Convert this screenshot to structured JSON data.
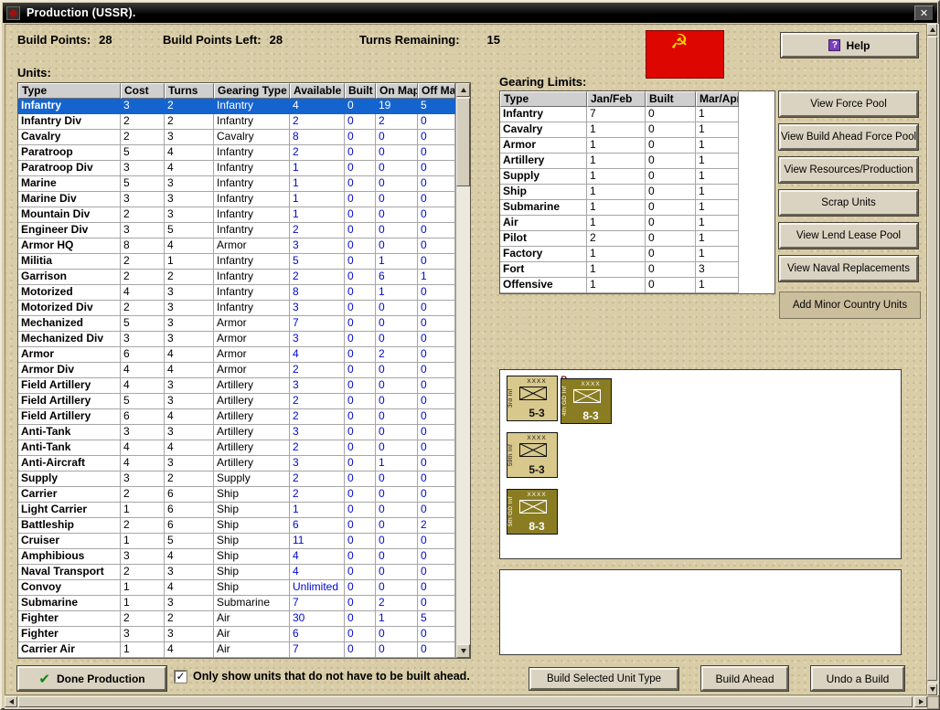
{
  "window": {
    "title": "Production (USSR).",
    "close_glyph": "✕"
  },
  "header": {
    "build_points_label": "Build Points:",
    "build_points": "28",
    "build_points_left_label": "Build Points Left:",
    "build_points_left": "28",
    "turns_remaining_label": "Turns Remaining:",
    "turns_remaining": "15",
    "help_label": "Help",
    "help_icon_glyph": "?"
  },
  "flag": {
    "country": "USSR",
    "emblem": "☭"
  },
  "units": {
    "label": "Units:",
    "columns": [
      "Type",
      "Cost",
      "Turns",
      "Gearing Type",
      "Available",
      "Built",
      "On Map",
      "Off Map"
    ],
    "selected_index": 0,
    "rows": [
      [
        "Infantry",
        3,
        2,
        "Infantry",
        4,
        0,
        19,
        5
      ],
      [
        "Infantry Div",
        2,
        2,
        "Infantry",
        2,
        0,
        2,
        0
      ],
      [
        "Cavalry",
        2,
        3,
        "Cavalry",
        8,
        0,
        0,
        0
      ],
      [
        "Paratroop",
        5,
        4,
        "Infantry",
        2,
        0,
        0,
        0
      ],
      [
        "Paratroop Div",
        3,
        4,
        "Infantry",
        1,
        0,
        0,
        0
      ],
      [
        "Marine",
        5,
        3,
        "Infantry",
        1,
        0,
        0,
        0
      ],
      [
        "Marine Div",
        3,
        3,
        "Infantry",
        1,
        0,
        0,
        0
      ],
      [
        "Mountain Div",
        2,
        3,
        "Infantry",
        1,
        0,
        0,
        0
      ],
      [
        "Engineer Div",
        3,
        5,
        "Infantry",
        2,
        0,
        0,
        0
      ],
      [
        "Armor HQ",
        8,
        4,
        "Armor",
        3,
        0,
        0,
        0
      ],
      [
        "Militia",
        2,
        1,
        "Infantry",
        5,
        0,
        1,
        0
      ],
      [
        "Garrison",
        2,
        2,
        "Infantry",
        2,
        0,
        6,
        1
      ],
      [
        "Motorized",
        4,
        3,
        "Infantry",
        8,
        0,
        1,
        0
      ],
      [
        "Motorized Div",
        2,
        3,
        "Infantry",
        3,
        0,
        0,
        0
      ],
      [
        "Mechanized",
        5,
        3,
        "Armor",
        7,
        0,
        0,
        0
      ],
      [
        "Mechanized Div",
        3,
        3,
        "Armor",
        3,
        0,
        0,
        0
      ],
      [
        "Armor",
        6,
        4,
        "Armor",
        4,
        0,
        2,
        0
      ],
      [
        "Armor Div",
        4,
        4,
        "Armor",
        2,
        0,
        0,
        0
      ],
      [
        "Field Artillery",
        4,
        3,
        "Artillery",
        3,
        0,
        0,
        0
      ],
      [
        "Field Artillery",
        5,
        3,
        "Artillery",
        2,
        0,
        0,
        0
      ],
      [
        "Field Artillery",
        6,
        4,
        "Artillery",
        2,
        0,
        0,
        0
      ],
      [
        "Anti-Tank",
        3,
        3,
        "Artillery",
        3,
        0,
        0,
        0
      ],
      [
        "Anti-Tank",
        4,
        4,
        "Artillery",
        2,
        0,
        0,
        0
      ],
      [
        "Anti-Aircraft",
        4,
        3,
        "Artillery",
        3,
        0,
        1,
        0
      ],
      [
        "Supply",
        3,
        2,
        "Supply",
        2,
        0,
        0,
        0
      ],
      [
        "Carrier",
        2,
        6,
        "Ship",
        2,
        0,
        0,
        0
      ],
      [
        "Light Carrier",
        1,
        6,
        "Ship",
        1,
        0,
        0,
        0
      ],
      [
        "Battleship",
        2,
        6,
        "Ship",
        6,
        0,
        0,
        2
      ],
      [
        "Cruiser",
        1,
        5,
        "Ship",
        11,
        0,
        0,
        0
      ],
      [
        "Amphibious",
        3,
        4,
        "Ship",
        4,
        0,
        0,
        0
      ],
      [
        "Naval Transport",
        2,
        3,
        "Ship",
        4,
        0,
        0,
        0
      ],
      [
        "Convoy",
        1,
        4,
        "Ship",
        "Unlimited",
        0,
        0,
        0
      ],
      [
        "Submarine",
        1,
        3,
        "Submarine",
        7,
        0,
        2,
        0
      ],
      [
        "Fighter",
        2,
        2,
        "Air",
        30,
        0,
        1,
        5
      ],
      [
        "Fighter",
        3,
        3,
        "Air",
        6,
        0,
        0,
        0
      ],
      [
        "Carrier Air",
        1,
        4,
        "Air",
        7,
        0,
        0,
        0
      ]
    ]
  },
  "gearing": {
    "label": "Gearing Limits:",
    "columns": [
      "Type",
      "Jan/Feb",
      "Built",
      "Mar/Apr"
    ],
    "rows": [
      [
        "Infantry",
        7,
        0,
        1
      ],
      [
        "Cavalry",
        1,
        0,
        1
      ],
      [
        "Armor",
        1,
        0,
        1
      ],
      [
        "Artillery",
        1,
        0,
        1
      ],
      [
        "Supply",
        1,
        0,
        1
      ],
      [
        "Ship",
        1,
        0,
        1
      ],
      [
        "Submarine",
        1,
        0,
        1
      ],
      [
        "Air",
        1,
        0,
        1
      ],
      [
        "Pilot",
        2,
        0,
        1
      ],
      [
        "Factory",
        1,
        0,
        1
      ],
      [
        "Fort",
        1,
        0,
        3
      ],
      [
        "Offensive",
        1,
        0,
        1
      ]
    ]
  },
  "side_buttons": [
    "View Force Pool",
    "View Build Ahead Force Pool",
    "View Resources/Production",
    "Scrap Units",
    "View Lend Lease Pool",
    "View Naval Replacements",
    "Add Minor Country Units"
  ],
  "counters": [
    {
      "name": "3rd Inf",
      "echelon": "XXXX",
      "strength": "5-3",
      "variant": "light",
      "badge": "R"
    },
    {
      "name": "4th GD Inf",
      "echelon": "XXXX",
      "strength": "8-3",
      "variant": "dark",
      "badge": ""
    },
    {
      "name": "59th Inf",
      "echelon": "XXXX",
      "strength": "5-3",
      "variant": "light",
      "badge": ""
    },
    {
      "name": "5th GD Inf",
      "echelon": "XXXX",
      "strength": "8-3",
      "variant": "dark",
      "badge": ""
    }
  ],
  "footer": {
    "done_label": "Done Production",
    "done_check_glyph": "✔",
    "checkbox_checked": true,
    "check_glyph": "✓",
    "checkbox_label": "Only show units that do not have to be built ahead.",
    "build_selected_label": "Build Selected Unit Type",
    "build_ahead_label": "Build Ahead",
    "undo_label": "Undo a Build"
  },
  "colors": {
    "selection_blue": "#1464d0",
    "value_blue": "#0008cf",
    "flag_red": "#dd0600",
    "flag_gold": "#ffcf00",
    "counter_light": "#d8c88c",
    "counter_dark": "#8a7c22",
    "background_sand": "#d9cda8"
  }
}
